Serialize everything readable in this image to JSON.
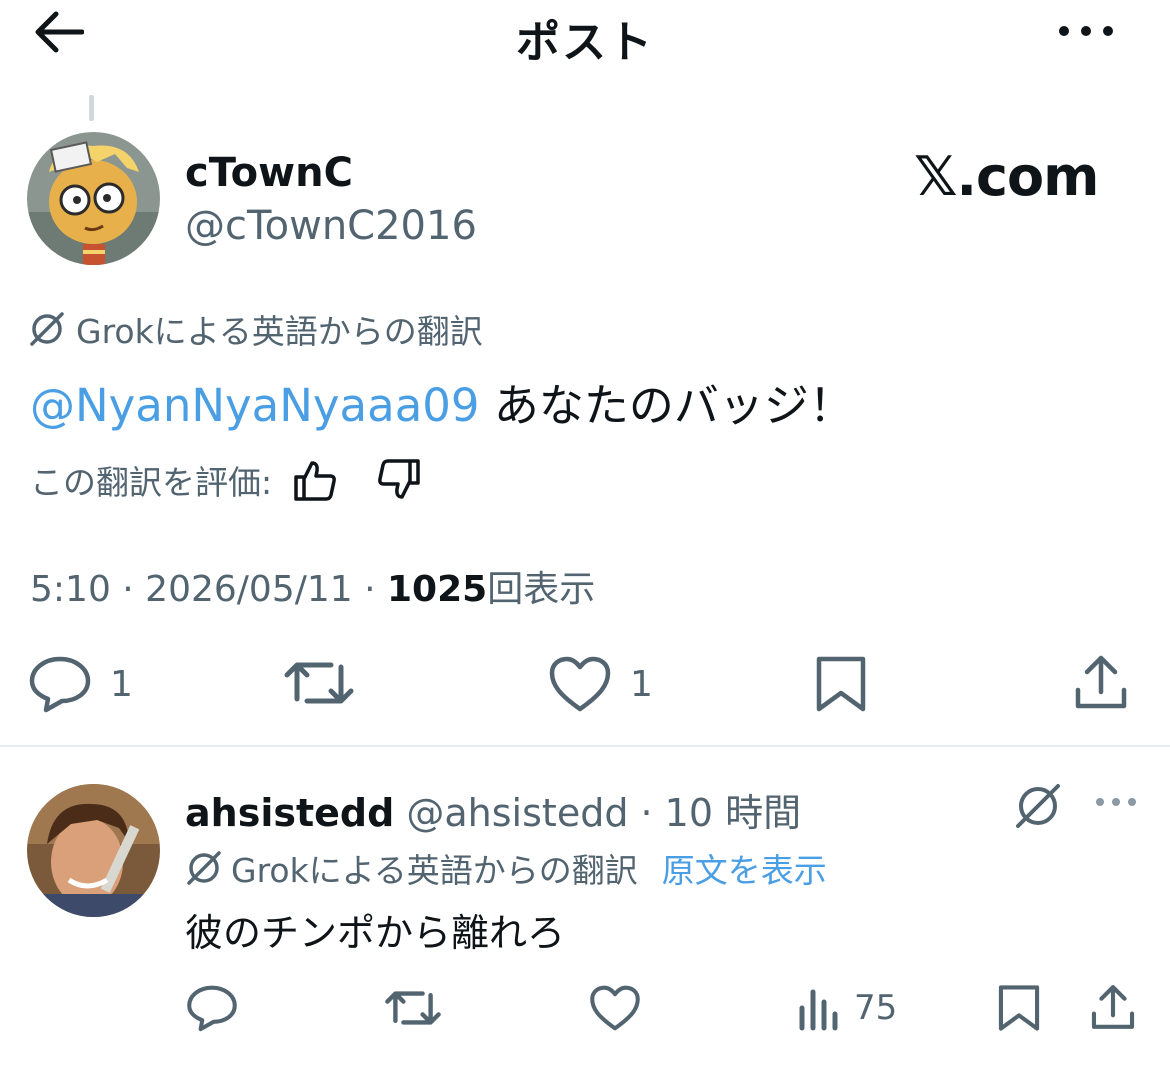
{
  "header": {
    "title": "ポスト",
    "back_icon": "arrow-left-icon",
    "more_icon": "more-horizontal-icon"
  },
  "post": {
    "author_name": "cTownC",
    "author_handle": "@cTownC2016",
    "watermark": "𝕏.com",
    "translation_label": "Grokによる英語からの翻訳",
    "mention": "@NyanNyaNyaaa09",
    "text": " あなたのバッジ！",
    "rate_label": "この翻訳を評価:",
    "time_meta": "5:10 · 2026/05/11 · ",
    "views_count": "1025",
    "views_label": "回表示",
    "actions": {
      "reply_count": "1",
      "like_count": "1"
    }
  },
  "reply": {
    "author_name": "ahsistedd",
    "author_handle": "@ahsistedd",
    "time": " · 10 時間",
    "translation_label": "Grokによる英語からの翻訳",
    "show_original": "原文を表示",
    "text": "彼のチンポから離れろ",
    "views_count": "75"
  },
  "colors": {
    "text": "#0f1419",
    "secondary": "#536471",
    "link": "#4a9ee4",
    "divider": "#e6ecf0"
  }
}
